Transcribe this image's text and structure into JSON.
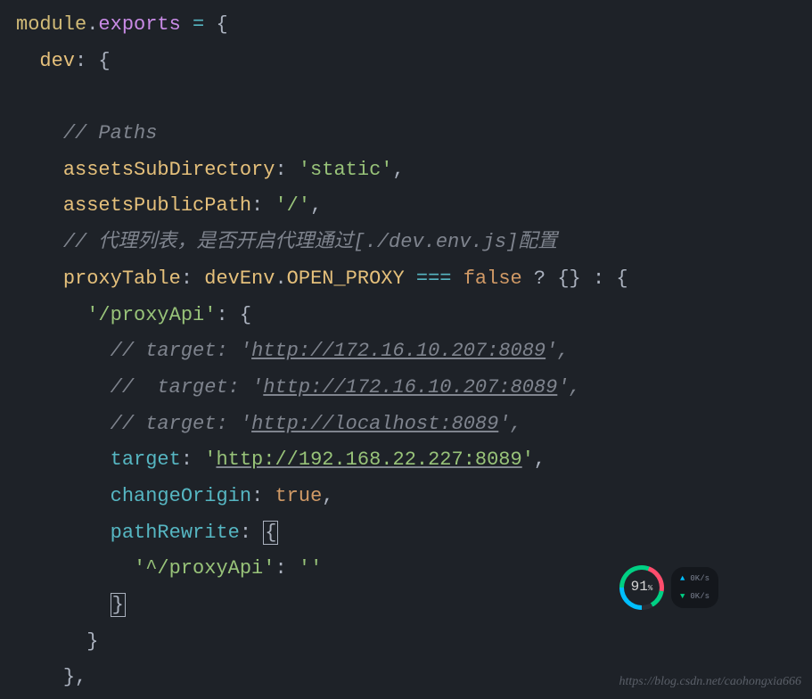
{
  "code": {
    "l1_module": "module",
    "l1_dot": ".",
    "l1_exports": "exports",
    "l1_eq": " = ",
    "l1_brace": "{",
    "l2_dev": "dev",
    "l2_colon": ": ",
    "l2_brace": "{",
    "l4_comment": "// Paths",
    "l5_key": "assetsSubDirectory",
    "l5_colon": ": ",
    "l5_val": "'static'",
    "l5_comma": ",",
    "l6_key": "assetsPublicPath",
    "l6_colon": ": ",
    "l6_val": "'/'",
    "l6_comma": ",",
    "l7_comment": "// 代理列表，是否开启代理通过[./dev.env.js]配置",
    "l8_key": "proxyTable",
    "l8_colon": ": ",
    "l8_devEnv": "devEnv",
    "l8_dot": ".",
    "l8_openproxy": "OPEN_PROXY",
    "l8_eqeq": " === ",
    "l8_false": "false",
    "l8_tern": " ? {} : {",
    "l9_key": "'/proxyApi'",
    "l9_colon": ": ",
    "l9_brace": "{",
    "l10_pre": "// target: '",
    "l10_url": "http://172.16.10.207:8089",
    "l10_post": "',",
    "l11_pre": "//  target: '",
    "l11_url": "http://172.16.10.207:8089",
    "l11_post": "',",
    "l12_pre": "// target: '",
    "l12_url": "http://localhost:8089",
    "l12_post": "',",
    "l13_key": "target",
    "l13_colon": ": ",
    "l13_q1": "'",
    "l13_url": "http://192.168.22.227:8089",
    "l13_q2": "'",
    "l13_comma": ",",
    "l14_key": "changeOrigin",
    "l14_colon": ": ",
    "l14_val": "true",
    "l14_comma": ",",
    "l15_key": "pathRewrite",
    "l15_colon": ": ",
    "l15_brace": "{",
    "l16_key": "'^/proxyApi'",
    "l16_colon": ": ",
    "l16_val": "''",
    "l17_brace": "}",
    "l18_brace": "}",
    "l19_brace": "},"
  },
  "widget": {
    "percent": "91",
    "pct_symbol": "%",
    "up_rate": "0K/s",
    "down_rate": "0K/s"
  },
  "watermark": "https://blog.csdn.net/caohongxia666"
}
